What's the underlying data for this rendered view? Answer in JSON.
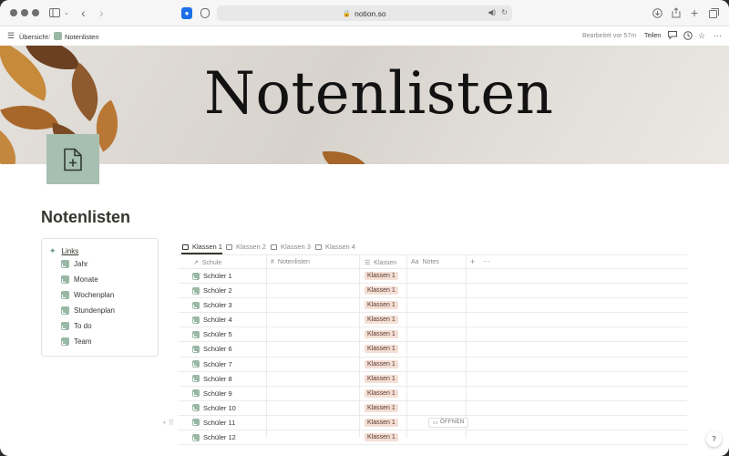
{
  "browser": {
    "url": "notion.so"
  },
  "topbar": {
    "breadcrumb_parent": "Übersicht",
    "breadcrumb_sep": "/",
    "breadcrumb_current": "Notenlisten",
    "edited": "Bearbeitet vor 57m",
    "share": "Teilen"
  },
  "cover": {
    "title": "Notenlisten"
  },
  "page": {
    "title": "Notenlisten"
  },
  "links": {
    "heading": "Links",
    "items": [
      "Jahr",
      "Monate",
      "Wochenplan",
      "Stundenplan",
      "To do",
      "Team"
    ]
  },
  "tabs": [
    "Klassen 1",
    "Klassen 2",
    "Klassen 3",
    "Klassen 4"
  ],
  "table": {
    "columns": [
      "Schule",
      "Notenlisten",
      "Klassen",
      "Notes"
    ],
    "rows": [
      {
        "name": "Schüler 1",
        "klassen": "Klassen 1"
      },
      {
        "name": "Schüler 2",
        "klassen": "Klassen 1"
      },
      {
        "name": "Schüler 3",
        "klassen": "Klassen 1"
      },
      {
        "name": "Schüler 4",
        "klassen": "Klassen 1"
      },
      {
        "name": "Schüler 5",
        "klassen": "Klassen 1"
      },
      {
        "name": "Schüler 6",
        "klassen": "Klassen 1"
      },
      {
        "name": "Schüler 7",
        "klassen": "Klassen 1"
      },
      {
        "name": "Schüler 8",
        "klassen": "Klassen 1"
      },
      {
        "name": "Schüler 9",
        "klassen": "Klassen 1"
      },
      {
        "name": "Schüler 10",
        "klassen": "Klassen 1"
      },
      {
        "name": "Schüler 11",
        "klassen": "Klassen 1"
      },
      {
        "name": "Schüler 12",
        "klassen": "Klassen 1"
      }
    ],
    "open_label": "ÖFFNEN"
  },
  "help": "?",
  "colors": {
    "page_icon_bg": "#a7bfb1",
    "tag_bg": "#f4dfd6",
    "text": "#37352f"
  }
}
